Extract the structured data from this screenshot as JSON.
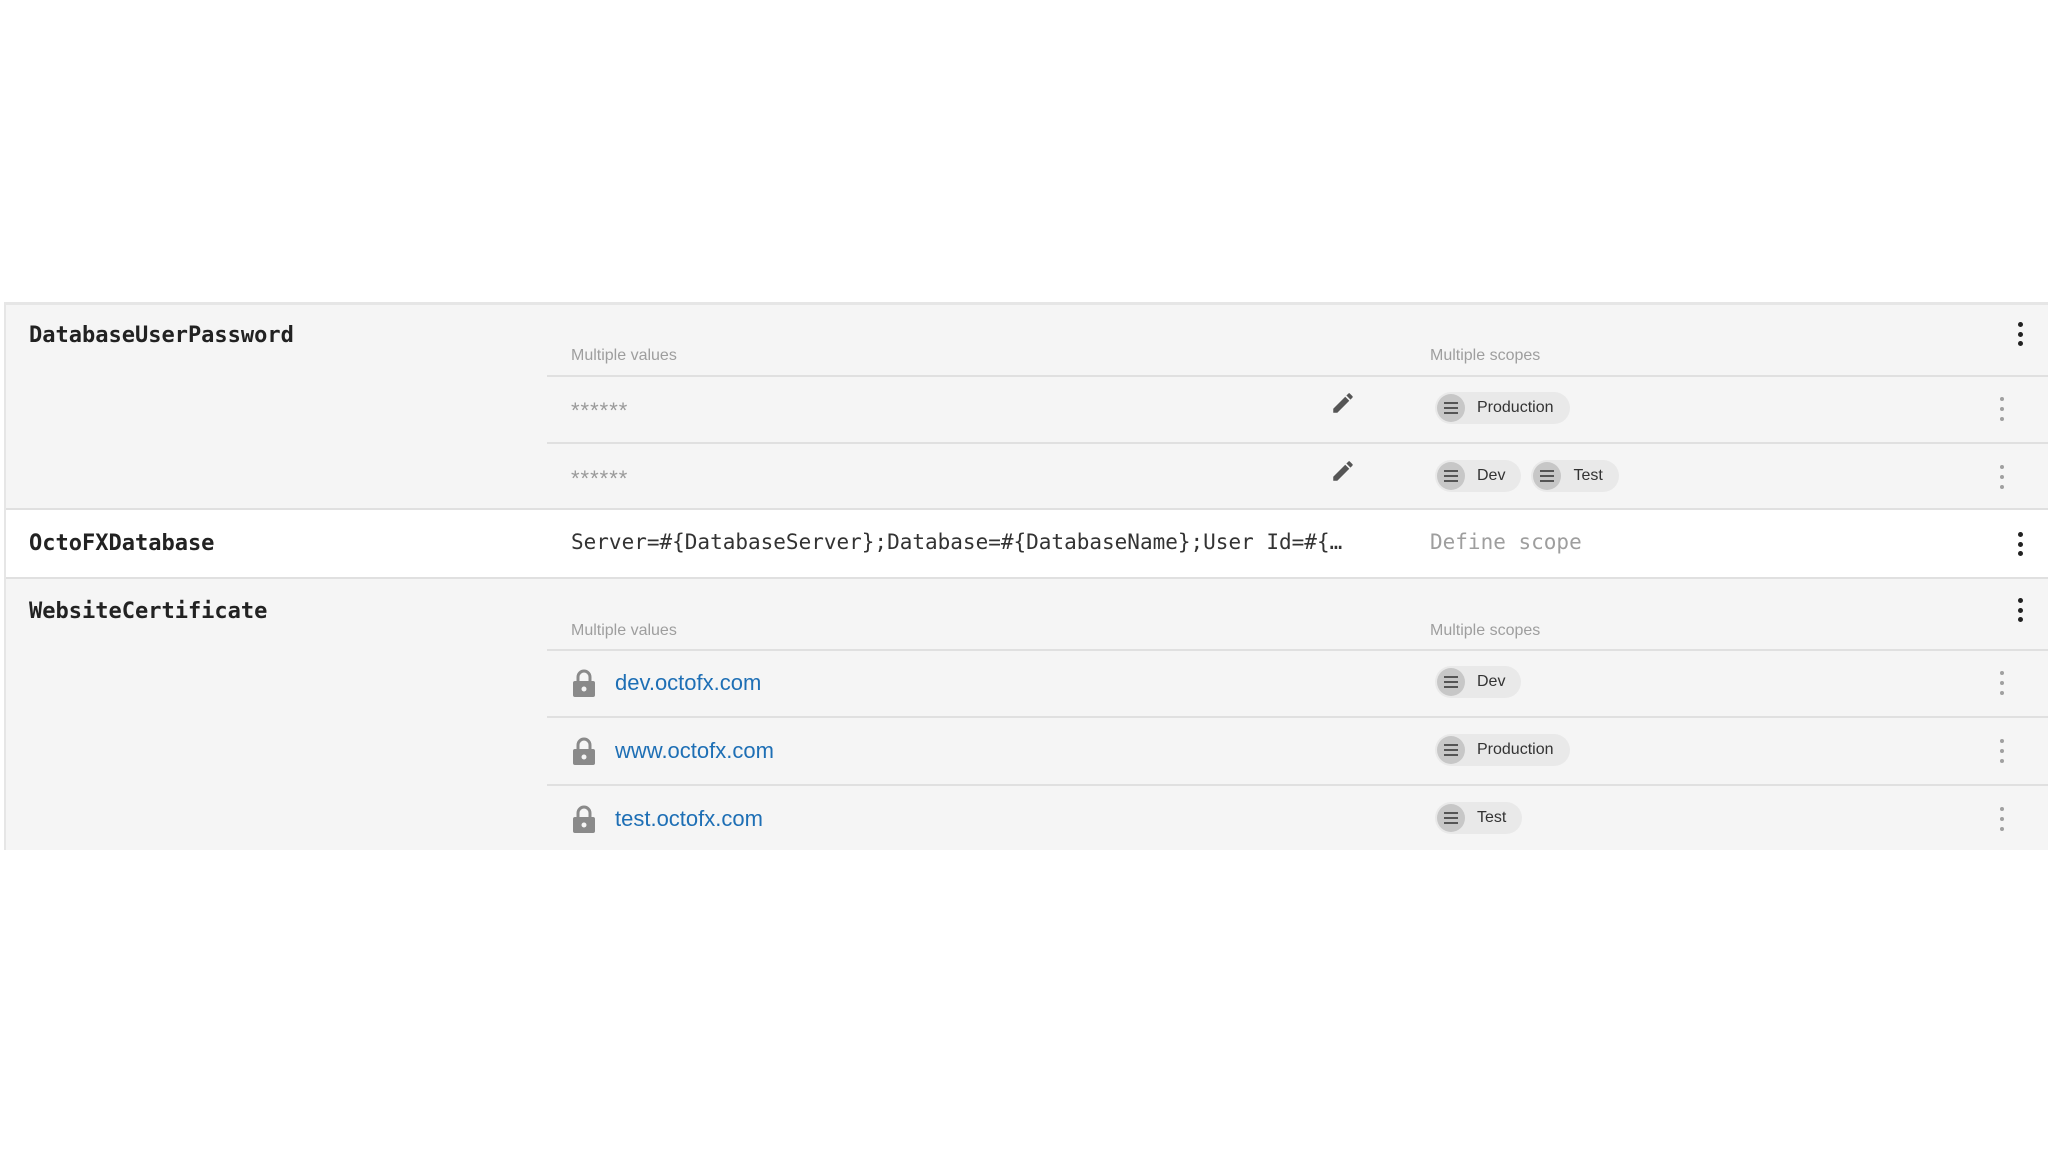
{
  "columns": {
    "values_header": "Multiple values",
    "scopes_header": "Multiple scopes"
  },
  "icons": {
    "edit": "pencil-icon",
    "scope": "list-icon",
    "more": "more-vertical-icon",
    "certificate": "lock-icon"
  },
  "colors": {
    "link": "#1e6fb5",
    "chip_background": "#e9e9e9",
    "row_background": "#f5f5f5"
  },
  "variables": [
    {
      "name": "DatabaseUserPassword",
      "values": [
        {
          "value": "******",
          "scopes": [
            "Production"
          ]
        },
        {
          "value": "******",
          "scopes": [
            "Dev",
            "Test"
          ]
        }
      ]
    },
    {
      "name": "OctoFXDatabase",
      "value": "Server=#{DatabaseServer};Database=#{DatabaseName};User Id=#{…",
      "scope_action": "Define scope"
    },
    {
      "name": "WebsiteCertificate",
      "values": [
        {
          "value": "dev.octofx.com",
          "scopes": [
            "Dev"
          ]
        },
        {
          "value": "www.octofx.com",
          "scopes": [
            "Production"
          ]
        },
        {
          "value": "test.octofx.com",
          "scopes": [
            "Test"
          ]
        }
      ]
    }
  ]
}
